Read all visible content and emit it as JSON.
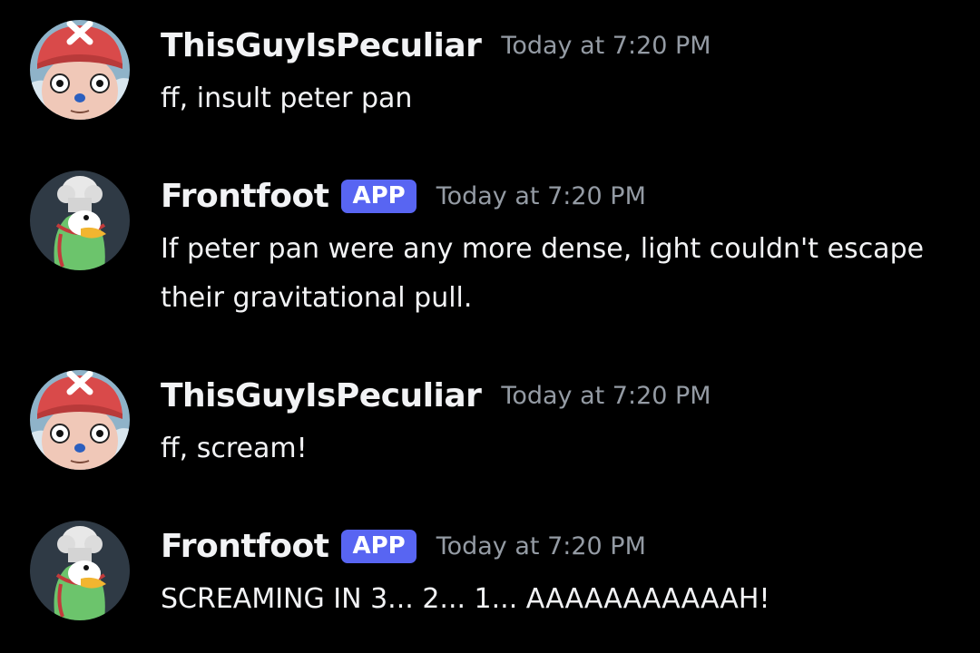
{
  "messages": [
    {
      "username": "ThisGuyIsPeculiar",
      "badge": "",
      "timestamp": "Today at 7:20 PM",
      "text": "ff, insult peter pan",
      "avatar": "chopper-avatar"
    },
    {
      "username": "Frontfoot",
      "badge": "APP",
      "timestamp": "Today at 7:20 PM",
      "text": "If peter pan were any more dense, light couldn't escape their gravitational pull.",
      "avatar": "penguin-chef-avatar"
    },
    {
      "username": "ThisGuyIsPeculiar",
      "badge": "",
      "timestamp": "Today at 7:20 PM",
      "text": "ff, scream!",
      "avatar": "chopper-avatar"
    },
    {
      "username": "Frontfoot",
      "badge": "APP",
      "timestamp": "Today at 7:20 PM",
      "text": "SCREAMING IN 3... 2... 1... AAAAAAAAAAAH!",
      "avatar": "penguin-chef-avatar"
    }
  ],
  "colors": {
    "background": "#000000",
    "username": "#f2f3f5",
    "timestamp": "#949ba4",
    "app_badge": "#5865f2"
  }
}
